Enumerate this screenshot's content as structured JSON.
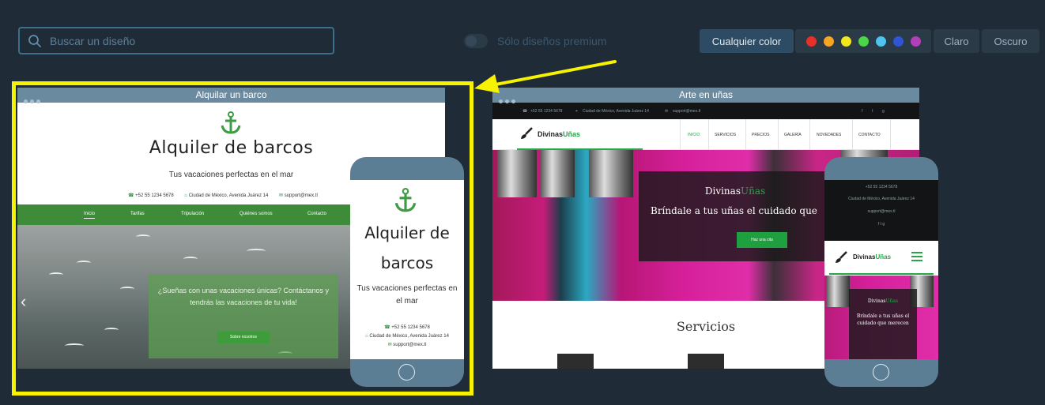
{
  "search": {
    "placeholder": "Buscar un diseño"
  },
  "premium": {
    "label": "Sólo diseños premium",
    "enabled": false
  },
  "color_filters": {
    "any_label": "Cualquier color",
    "swatches": [
      {
        "name": "red",
        "color": "#e8302a"
      },
      {
        "name": "orange",
        "color": "#f5a623"
      },
      {
        "name": "yellow",
        "color": "#f2e61d"
      },
      {
        "name": "green",
        "color": "#4cd64a"
      },
      {
        "name": "light-blue",
        "color": "#4ec3f0"
      },
      {
        "name": "blue",
        "color": "#2f55d4"
      },
      {
        "name": "purple",
        "color": "#b23fb8"
      }
    ],
    "light_label": "Claro",
    "dark_label": "Oscuro"
  },
  "highlight_color": "#f7f200",
  "templates": [
    {
      "window_title": "Alquilar un barco",
      "site": {
        "title": "Alquiler de barcos",
        "tagline": "Tus vacaciones perfectas en el mar",
        "phone": "+52 55 1234 5678",
        "address": "Ciudad de México, Avenida Juárez 14",
        "email": "support@mex.tl",
        "nav": [
          "Inicio",
          "Tarifas",
          "Tripulación",
          "Quiénes somos",
          "Contacto"
        ],
        "hero_text": "¿Sueñas con unas vacaciones únicas? Contáctanos y tendrás las vacaciones de tu vida!",
        "hero_button": "Sobre nosotros",
        "brand_color": "#3e8b3a"
      }
    },
    {
      "window_title": "Arte en uñas",
      "site": {
        "brand_a": "Divinas",
        "brand_b": "Uñas",
        "phone": "+52 55 1234 5678",
        "address": "Ciudad de México, Avenida Juárez 14",
        "email": "support@mex.tl",
        "nav": [
          "INICIO",
          "SERVICIOS",
          "PRECIOS",
          "GALERÍA",
          "NOVEDADES",
          "CONTACTO"
        ],
        "slogan": "Bríndale a tus uñas el cuidado que",
        "mobile_slogan": "Bríndale a tus uñas el cuidado que merecen",
        "hero_button": "Haz una cita",
        "services_title": "Servicios",
        "social": [
          "f",
          "t",
          "g"
        ],
        "brand_color": "#2aa44b"
      }
    }
  ]
}
